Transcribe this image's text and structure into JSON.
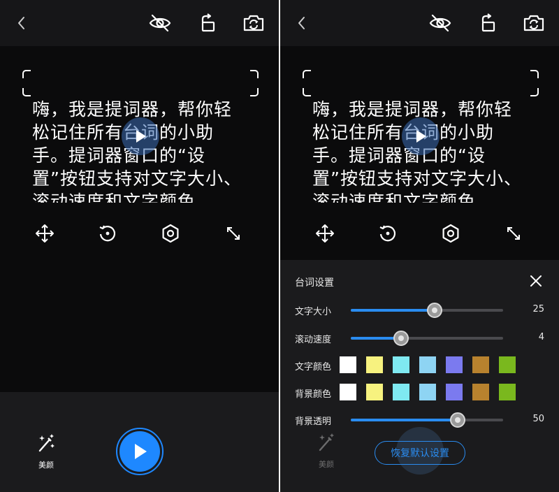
{
  "script": {
    "text": "嗨，我是提词器，帮你轻松记住所有台词的小助手。提词器窗口的“设置”按钮支持对文字大小、滚动速度和文字颜色"
  },
  "bottom": {
    "beauty_label": "美颜"
  },
  "settings": {
    "title": "台词设置",
    "font_size": {
      "label": "文字大小",
      "value": "25",
      "level": 0.55
    },
    "scroll_speed": {
      "label": "滚动速度",
      "value": "4",
      "level": 0.33
    },
    "text_color": {
      "label": "文字颜色"
    },
    "bg_color": {
      "label": "背景颜色"
    },
    "bg_opacity": {
      "label": "背景透明",
      "value": "50",
      "level": 0.7
    },
    "reset_label": "恢复默认设置"
  },
  "swatch_colors": [
    "#ffffff",
    "#f7f27f",
    "#7fe9f1",
    "#8ed4f3",
    "#7b7aef",
    "#b8822e",
    "#7ab81e"
  ],
  "colors": {
    "accent": "#1e88ff",
    "bg": "#0b0b0c",
    "bar": "#161618"
  },
  "icons": [
    "back-icon",
    "eye-off-icon",
    "rotate-icon",
    "camera-switch-icon",
    "move-icon",
    "restart-icon",
    "settings-icon",
    "resize-icon",
    "beauty-icon",
    "play-icon",
    "close-icon"
  ]
}
